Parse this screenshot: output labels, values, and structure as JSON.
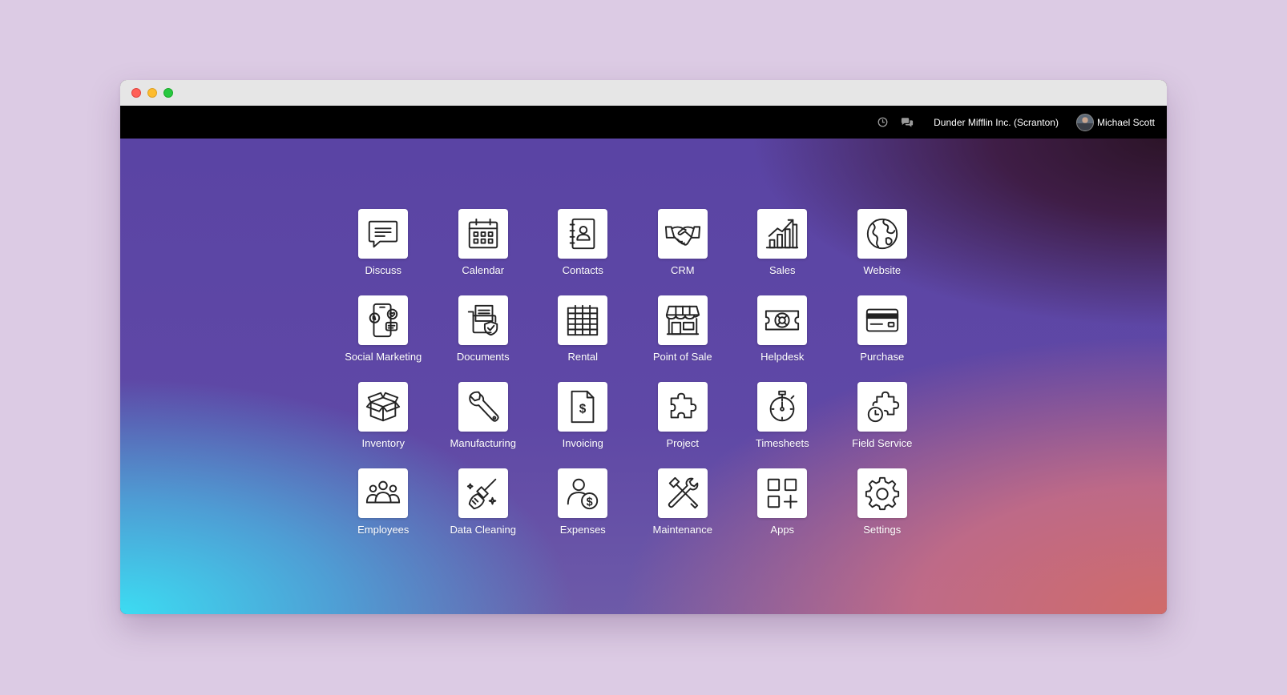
{
  "topbar": {
    "company": "Dunder Mifflin Inc. (Scranton)",
    "user_name": "Michael Scott",
    "icons": [
      "clock-icon",
      "chat-icon"
    ]
  },
  "colors": {
    "navbar": "#000000",
    "tile": "#ffffff",
    "gradient_top": "#5a44a4",
    "gradient_bottom_left": "#3cdcf2",
    "gradient_bottom_right": "#d06b6a",
    "gradient_top_right": "#2c1428"
  },
  "apps": [
    {
      "label": "Discuss",
      "icon": "chat-bubble-icon"
    },
    {
      "label": "Calendar",
      "icon": "calendar-icon"
    },
    {
      "label": "Contacts",
      "icon": "contacts-book-icon"
    },
    {
      "label": "CRM",
      "icon": "handshake-icon"
    },
    {
      "label": "Sales",
      "icon": "bar-chart-icon"
    },
    {
      "label": "Website",
      "icon": "globe-icon"
    },
    {
      "label": "Social Marketing",
      "icon": "phone-social-icon"
    },
    {
      "label": "Documents",
      "icon": "folder-shield-icon"
    },
    {
      "label": "Rental",
      "icon": "grid-calendar-icon"
    },
    {
      "label": "Point of Sale",
      "icon": "shop-icon"
    },
    {
      "label": "Helpdesk",
      "icon": "lifebuoy-ticket-icon"
    },
    {
      "label": "Purchase",
      "icon": "credit-card-icon"
    },
    {
      "label": "Inventory",
      "icon": "box-icon"
    },
    {
      "label": "Manufacturing",
      "icon": "wrench-icon"
    },
    {
      "label": "Invoicing",
      "icon": "invoice-dollar-icon"
    },
    {
      "label": "Project",
      "icon": "puzzle-icon"
    },
    {
      "label": "Timesheets",
      "icon": "stopwatch-icon"
    },
    {
      "label": "Field Service",
      "icon": "puzzle-clock-icon"
    },
    {
      "label": "Employees",
      "icon": "people-icon"
    },
    {
      "label": "Data Cleaning",
      "icon": "broom-icon"
    },
    {
      "label": "Expenses",
      "icon": "person-dollar-icon"
    },
    {
      "label": "Maintenance",
      "icon": "hammer-wrench-icon"
    },
    {
      "label": "Apps",
      "icon": "apps-grid-icon"
    },
    {
      "label": "Settings",
      "icon": "gear-icon"
    }
  ]
}
